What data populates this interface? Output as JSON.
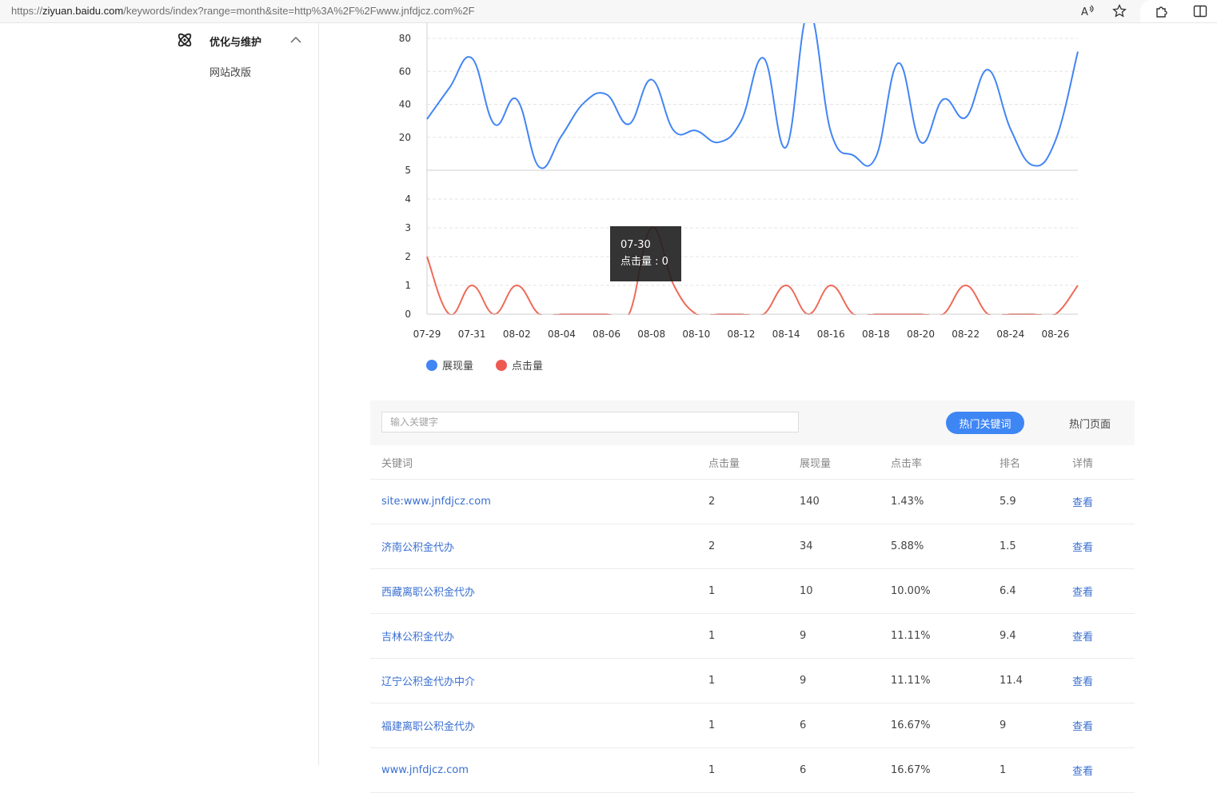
{
  "browser": {
    "url_host_prefix": "https://",
    "url_host": "ziyuan.baidu.com",
    "url_path": "/keywords/index?range=month&site=http%3A%2F%2Fwww.jnfdjcz.com%2F",
    "icons": [
      "read-aloud-icon",
      "favorite-star-icon",
      "extensions-icon",
      "split-screen-icon"
    ]
  },
  "sidebar": {
    "section_label": "优化与维护",
    "items": [
      {
        "label": "网站改版"
      }
    ]
  },
  "chart_data": {
    "type": "line",
    "x": [
      "07-29",
      "07-30",
      "07-31",
      "08-01",
      "08-02",
      "08-03",
      "08-04",
      "08-05",
      "08-06",
      "08-07",
      "08-08",
      "08-09",
      "08-10",
      "08-11",
      "08-12",
      "08-13",
      "08-14",
      "08-15",
      "08-16",
      "08-17",
      "08-18",
      "08-19",
      "08-20",
      "08-21",
      "08-22",
      "08-23",
      "08-24",
      "08-25",
      "08-26",
      "08-27"
    ],
    "x_tick_labels": [
      "07-29",
      "07-31",
      "08-02",
      "08-04",
      "08-06",
      "08-08",
      "08-10",
      "08-12",
      "08-14",
      "08-16",
      "08-18",
      "08-20",
      "08-22",
      "08-24",
      "08-26"
    ],
    "panels": [
      {
        "name": "展现量",
        "color": "#4285f4",
        "ylim": [
          0,
          80
        ],
        "yticks": [
          20,
          40,
          60,
          80
        ],
        "values": [
          31,
          50,
          68,
          28,
          43,
          2,
          21,
          41,
          46,
          28,
          55,
          24,
          24,
          17,
          30,
          68,
          14,
          96,
          23,
          9,
          8,
          65,
          17,
          43,
          32,
          61,
          25,
          3,
          18,
          72
        ]
      },
      {
        "name": "点击量",
        "color": "#ee6b59",
        "ylim": [
          0,
          5
        ],
        "yticks": [
          0,
          1,
          2,
          3,
          4,
          5
        ],
        "values": [
          2,
          0,
          1,
          0,
          1,
          0,
          0,
          0,
          0,
          0,
          3,
          1,
          0,
          0,
          0,
          0,
          1,
          0,
          1,
          0,
          0,
          0,
          0,
          0,
          1,
          0,
          0,
          0,
          0,
          1
        ]
      }
    ],
    "legend": [
      "展现量",
      "点击量"
    ],
    "grid": true,
    "legend_position": "bottom-left"
  },
  "tooltip": {
    "date": "07-30",
    "text": "点击量 : 0"
  },
  "search": {
    "placeholder": "输入关键字"
  },
  "tabs": {
    "active": "热门关键词",
    "other": "热门页面"
  },
  "table": {
    "headers": [
      "关键词",
      "点击量",
      "展现量",
      "点击率",
      "排名",
      "详情"
    ],
    "rows": [
      {
        "keyword": "site:www.jnfdjcz.com",
        "clicks": "2",
        "impressions": "140",
        "ctr": "1.43%",
        "rank": "5.9",
        "detail": "查看"
      },
      {
        "keyword": "济南公积金代办",
        "clicks": "2",
        "impressions": "34",
        "ctr": "5.88%",
        "rank": "1.5",
        "detail": "查看"
      },
      {
        "keyword": "西藏离职公积金代办",
        "clicks": "1",
        "impressions": "10",
        "ctr": "10.00%",
        "rank": "6.4",
        "detail": "查看"
      },
      {
        "keyword": "吉林公积金代办",
        "clicks": "1",
        "impressions": "9",
        "ctr": "11.11%",
        "rank": "9.4",
        "detail": "查看"
      },
      {
        "keyword": "辽宁公积金代办中介",
        "clicks": "1",
        "impressions": "9",
        "ctr": "11.11%",
        "rank": "11.4",
        "detail": "查看"
      },
      {
        "keyword": "福建离职公积金代办",
        "clicks": "1",
        "impressions": "6",
        "ctr": "16.67%",
        "rank": "9",
        "detail": "查看"
      },
      {
        "keyword": "www.jnfdjcz.com",
        "clicks": "1",
        "impressions": "6",
        "ctr": "16.67%",
        "rank": "1",
        "detail": "查看"
      }
    ]
  }
}
